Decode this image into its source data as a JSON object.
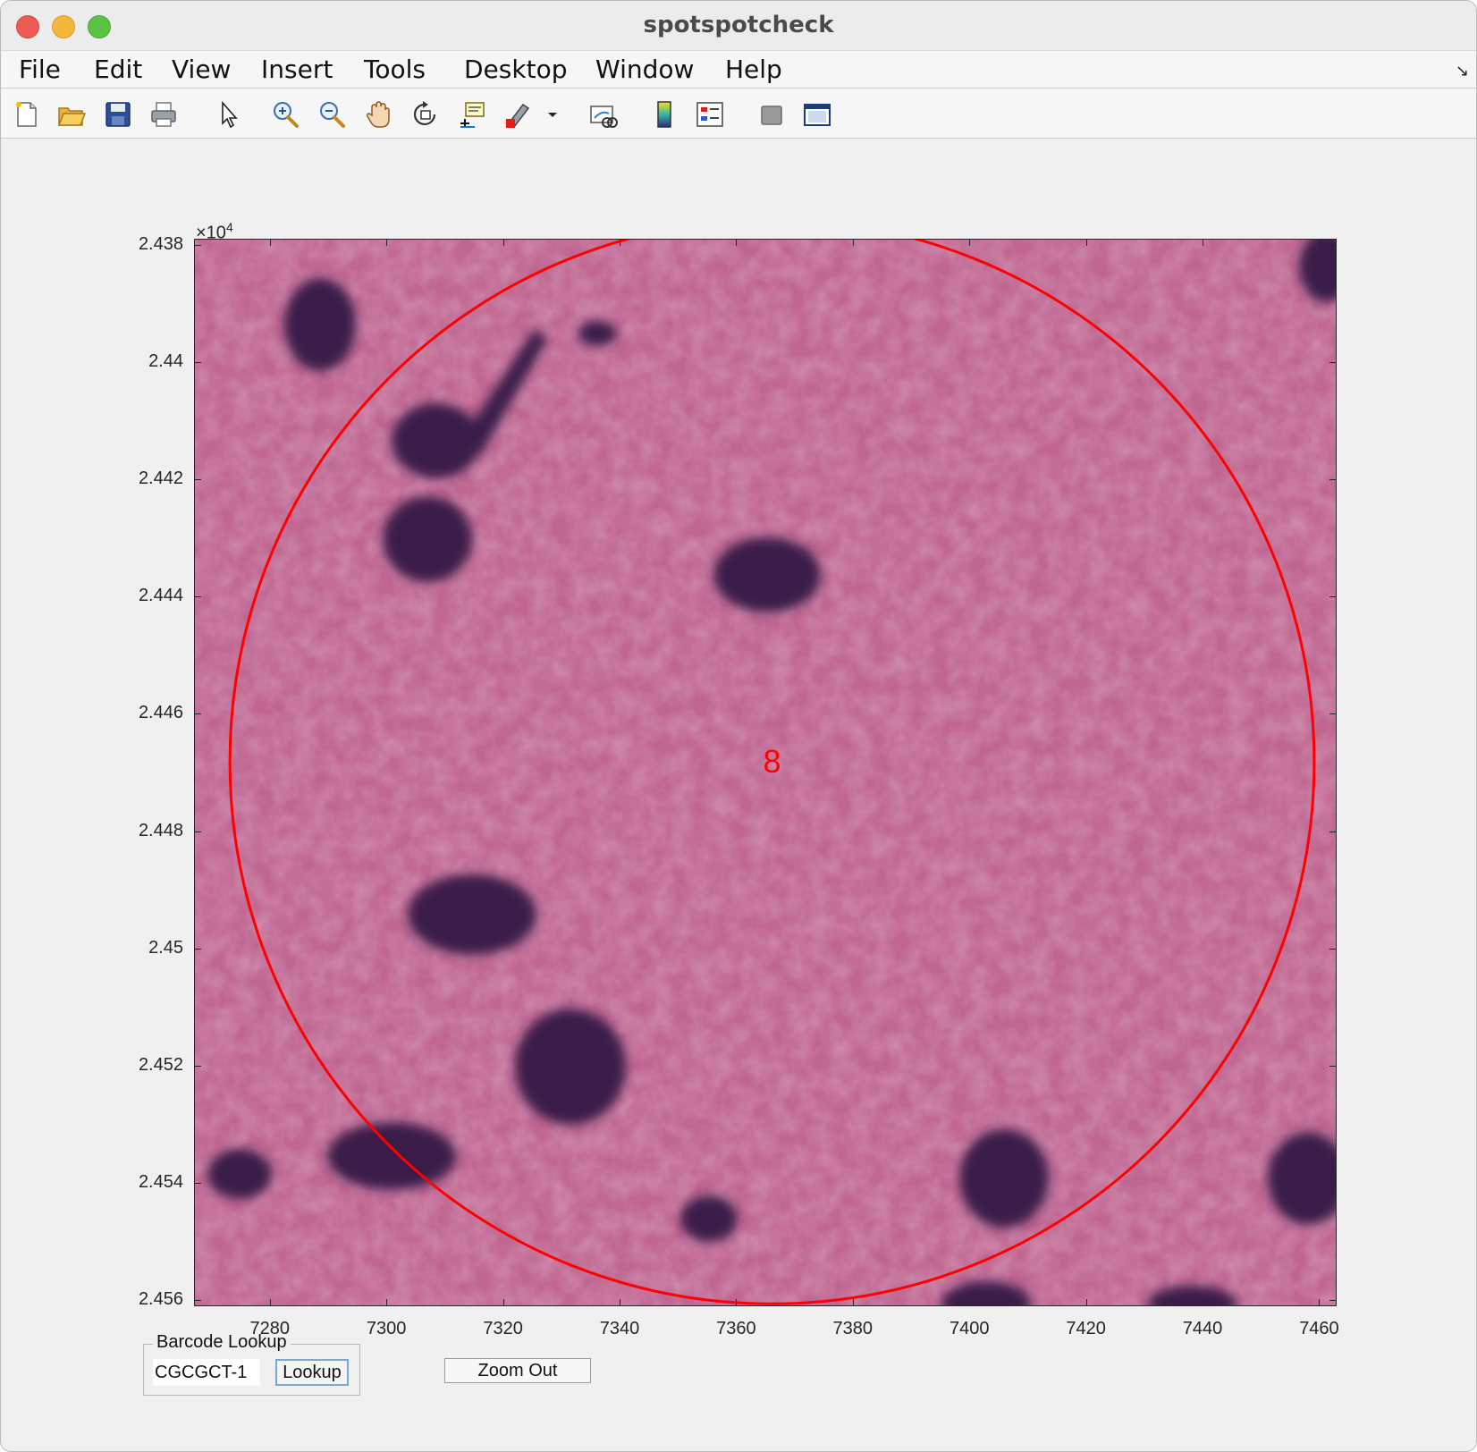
{
  "window": {
    "title": "spotspotcheck"
  },
  "menubar": {
    "items": [
      "File",
      "Edit",
      "View",
      "Insert",
      "Tools",
      "Desktop",
      "Window",
      "Help"
    ]
  },
  "toolbar": {
    "icons": [
      "new-figure-icon",
      "open-file-icon",
      "save-icon",
      "print-icon",
      "edit-plot-arrow-icon",
      "zoom-in-icon",
      "zoom-out-icon",
      "pan-hand-icon",
      "rotate-3d-icon",
      "data-cursor-icon",
      "brush-icon",
      "brush-dropdown-icon",
      "link-plot-icon",
      "colorbar-icon",
      "legend-icon",
      "hide-plot-tools-icon",
      "show-plot-tools-icon"
    ]
  },
  "plot": {
    "y_exponent_base": "×10",
    "y_exponent_power": "4",
    "spot_label": "8",
    "spot_circle_color": "#ff0000",
    "tissue_color": "#c46a95",
    "nucleus_color": "#3a1a4a"
  },
  "chart_data": {
    "type": "image",
    "xlabel": "",
    "ylabel": "",
    "xlim": [
      7267,
      7463
    ],
    "ylim": [
      24379,
      24561
    ],
    "y_reversed": true,
    "x_ticks": [
      "7280",
      "7300",
      "7320",
      "7340",
      "7360",
      "7380",
      "7400",
      "7420",
      "7440",
      "7460"
    ],
    "y_ticks": [
      "2.438",
      "2.44",
      "2.442",
      "2.444",
      "2.446",
      "2.448",
      "2.45",
      "2.452",
      "2.454",
      "2.456"
    ],
    "x_tick_values": [
      7280,
      7300,
      7320,
      7340,
      7360,
      7380,
      7400,
      7420,
      7440,
      7460
    ],
    "y_tick_values": [
      24380,
      24400,
      24420,
      24440,
      24460,
      24480,
      24500,
      24520,
      24540,
      24560
    ],
    "spots": [
      {
        "label": "8",
        "cx": 7366,
        "cy": 24468,
        "r": 93
      }
    ]
  },
  "controls": {
    "barcode_panel_title": "Barcode Lookup",
    "barcode_value": "CGCGCT-1",
    "lookup_label": "Lookup",
    "zoom_out_label": "Zoom Out"
  }
}
